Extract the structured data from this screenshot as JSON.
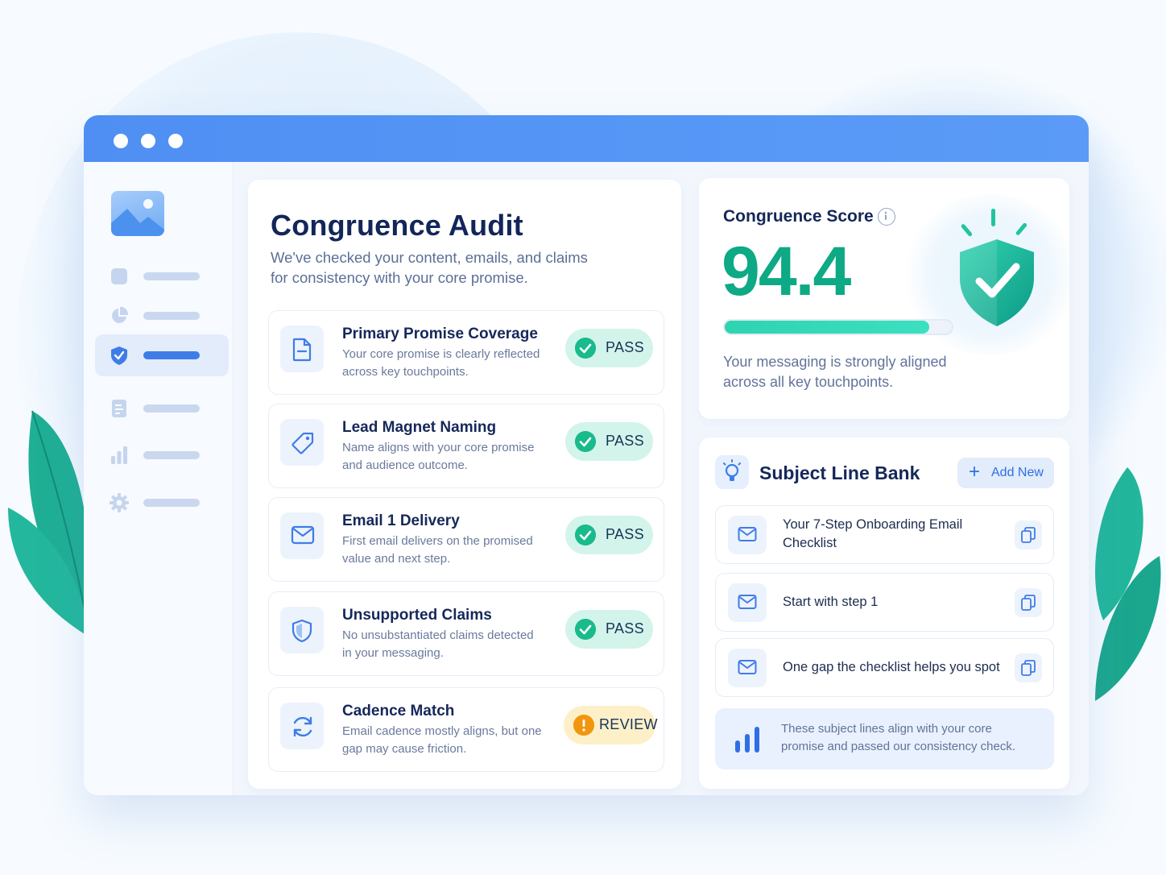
{
  "audit": {
    "title": "Congruence Audit",
    "subtitle_line1": "We've checked your content, emails, and claims",
    "subtitle_line2": "for consistency with your core promise.",
    "checks": [
      {
        "title": "Primary Promise Coverage",
        "desc_line1": "Your core promise is clearly reflected",
        "desc_line2": "across key touchpoints.",
        "status": "PASS",
        "icon": "document-icon"
      },
      {
        "title": "Lead Magnet Naming",
        "desc_line1": "Name aligns with your core promise",
        "desc_line2": "and audience outcome.",
        "status": "PASS",
        "icon": "tag-icon"
      },
      {
        "title": "Email 1 Delivery",
        "desc_line1": "First email delivers on the promised",
        "desc_line2": "value and next step.",
        "status": "PASS",
        "icon": "mail-icon"
      },
      {
        "title": "Unsupported Claims",
        "desc_line1": "No unsubstantiated claims detected",
        "desc_line2": "in your messaging.",
        "status": "PASS",
        "icon": "shield-icon"
      },
      {
        "title": "Cadence Match",
        "desc_line1": "Email cadence mostly aligns, but one",
        "desc_line2": "gap may cause friction.",
        "status": "REVIEW",
        "icon": "refresh-icon"
      }
    ]
  },
  "score": {
    "label": "Congruence Score",
    "value": "94.4",
    "progress_fraction": 0.9,
    "desc_line1": "Your messaging is strongly aligned",
    "desc_line2": "across all key touchpoints."
  },
  "bank": {
    "title": "Subject Line Bank",
    "add_label": "Add New",
    "items": [
      {
        "line1": "Your 7-Step Onboarding Email",
        "line2": "Checklist"
      },
      {
        "line1": "Start with step 1",
        "line2": ""
      },
      {
        "line1": "One gap the checklist helps you spot",
        "line2": ""
      }
    ],
    "note_line1": "These subject lines align with your core",
    "note_line2": "promise and passed our consistency check."
  },
  "colors": {
    "accent": "#3f7ce8",
    "pass": "#19ba8c",
    "review": "#f2950f",
    "score": "#0ea985"
  }
}
